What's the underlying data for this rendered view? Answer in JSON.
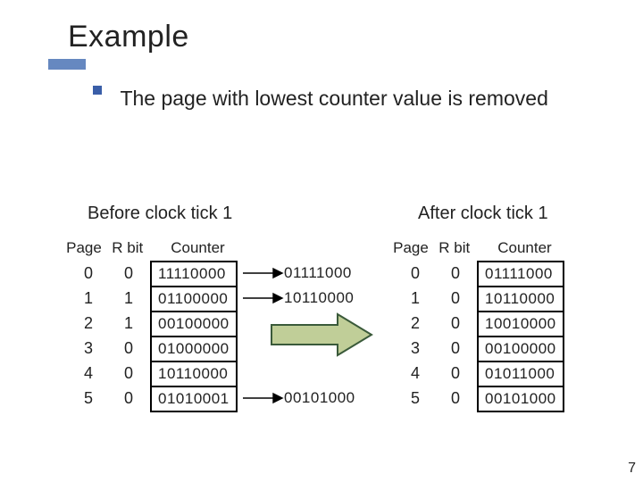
{
  "title": "Example",
  "bullet": "The page with lowest counter value is removed",
  "captions": {
    "before": "Before clock tick 1",
    "after": "After clock tick 1"
  },
  "headers": {
    "page": "Page",
    "rbit": "R bit",
    "counter": "Counter"
  },
  "before": {
    "page": [
      "0",
      "1",
      "2",
      "3",
      "4",
      "5"
    ],
    "rbit": [
      "0",
      "1",
      "1",
      "0",
      "0",
      "0"
    ],
    "counter": [
      "11110000",
      "01100000",
      "00100000",
      "01000000",
      "10110000",
      "01010001"
    ]
  },
  "middle": [
    "01111000",
    "10110000",
    "",
    "",
    "",
    "00101000"
  ],
  "after": {
    "page": [
      "0",
      "1",
      "2",
      "3",
      "4",
      "5"
    ],
    "rbit": [
      "0",
      "0",
      "0",
      "0",
      "0",
      "0"
    ],
    "counter": [
      "01111000",
      "10110000",
      "10010000",
      "00100000",
      "01011000",
      "00101000"
    ]
  },
  "colors": {
    "accent": "#6688c0",
    "bullet": "#3a5ea8",
    "arrow_fill": "#c0ce98",
    "arrow_stroke": "#3a5a3a"
  },
  "page_number": "7",
  "chart_data": {
    "type": "table",
    "title": "Aging page-replacement counter example",
    "before_tick": 1,
    "rows": [
      {
        "page": 0,
        "rbit": 0,
        "counter_before": "11110000",
        "counter_after": "01111000"
      },
      {
        "page": 1,
        "rbit": 1,
        "counter_before": "01100000",
        "counter_after": "10110000"
      },
      {
        "page": 2,
        "rbit": 1,
        "counter_before": "00100000",
        "counter_after": "10010000"
      },
      {
        "page": 3,
        "rbit": 0,
        "counter_before": "01000000",
        "counter_after": "00100000"
      },
      {
        "page": 4,
        "rbit": 0,
        "counter_before": "10110000",
        "counter_after": "01011000"
      },
      {
        "page": 5,
        "rbit": 0,
        "counter_before": "01010001",
        "counter_after": "00101000"
      }
    ]
  }
}
